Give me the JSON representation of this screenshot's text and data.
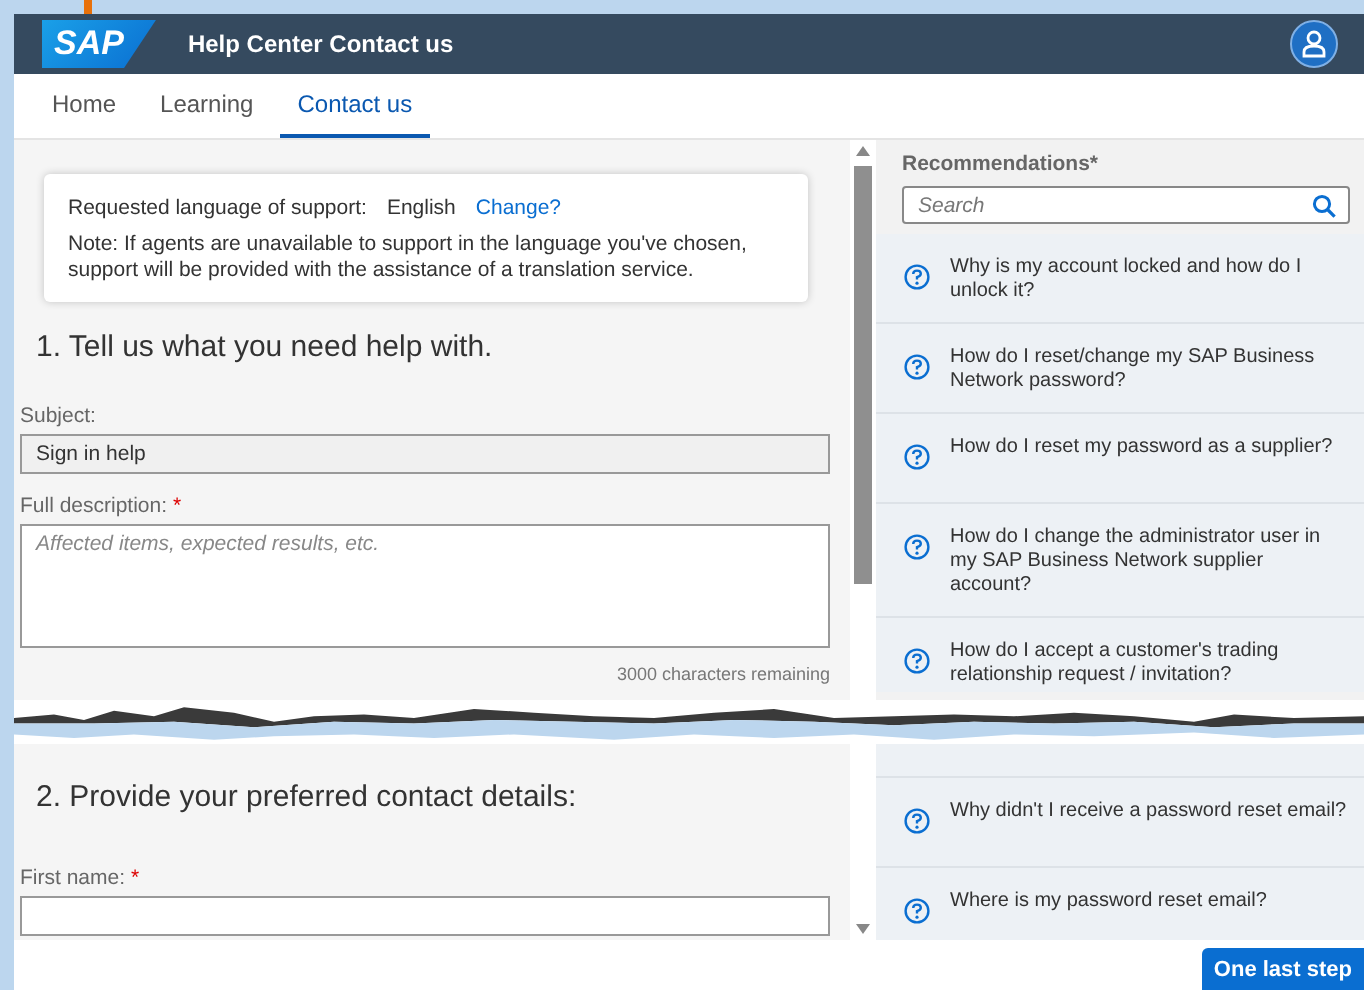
{
  "window": {
    "logo": "SAP",
    "title": "Help Center Contact us"
  },
  "tabs": [
    {
      "label": "Home",
      "selected": false
    },
    {
      "label": "Learning",
      "selected": false
    },
    {
      "label": "Contact us",
      "selected": true
    }
  ],
  "language": {
    "label": "Requested language of support:",
    "value": "English",
    "link": "Change?",
    "note": "Note: If agents are unavailable to support in the language you've chosen, support will be provided with the assistance of a translation service."
  },
  "section_1": {
    "heading": "1. Tell us what you need help with.",
    "subject": {
      "label": "Subject:",
      "value": "Sign in help"
    },
    "description": {
      "label": "Full description:",
      "required_mark": "*",
      "placeholder": "Affected items, expected results, etc.",
      "counter": "3000 characters remaining"
    }
  },
  "section_2": {
    "heading": "2. Provide your preferred contact details:",
    "first_name": {
      "label": "First name:",
      "required_mark": "*"
    }
  },
  "recommendations": {
    "title": "Recommendations*",
    "search": {
      "placeholder": "Search"
    },
    "items_above_tear": [
      "Why is my account locked and how do I unlock it?",
      "How do I reset/change my SAP Business Network password?",
      "How do I reset my password as a supplier?",
      "How do I change the administrator user in my SAP Business Network supplier account?",
      "How do I accept a customer's trading relationship request / invitation?"
    ],
    "items_below_tear": [
      "Why didn't I receive a password reset email?",
      "Where is my password reset email?"
    ]
  },
  "primary_button": "One last step"
}
